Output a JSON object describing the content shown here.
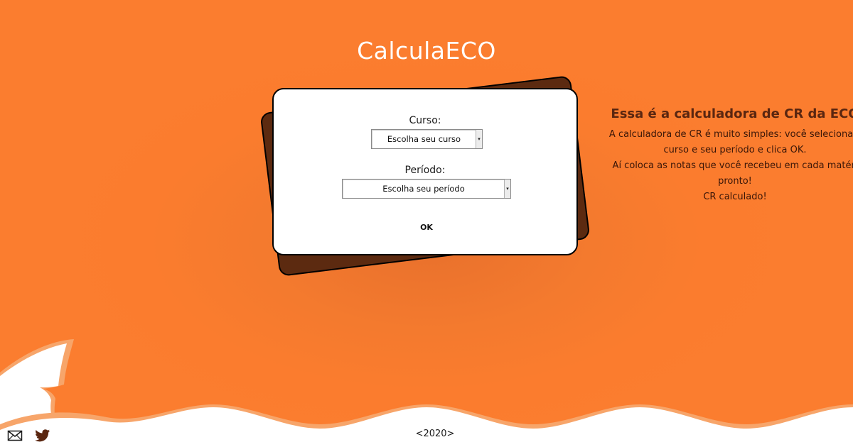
{
  "app": {
    "title": "CalculaECO"
  },
  "form": {
    "curso_label": "Curso:",
    "curso_value": "Escolha seu curso",
    "periodo_label": "Período:",
    "periodo_value": "Escolha seu período",
    "ok_label": "OK"
  },
  "info": {
    "title": "Essa é a calculadora de CR da ECO",
    "lines": [
      "A calculadora de CR é muito simples: você seleciona s",
      "curso e seu período e clica OK.",
      "Aí coloca as notas que você recebeu em cada matéri",
      "pronto!",
      "CR calculado!"
    ]
  },
  "footer": {
    "year": "<2020>",
    "icons": [
      "mail-icon",
      "twitter-icon"
    ]
  },
  "colors": {
    "background": "#fb7d2f",
    "card_back": "#5c2a10",
    "info_title": "#5a2610",
    "wave_light": "#f7a56a"
  }
}
